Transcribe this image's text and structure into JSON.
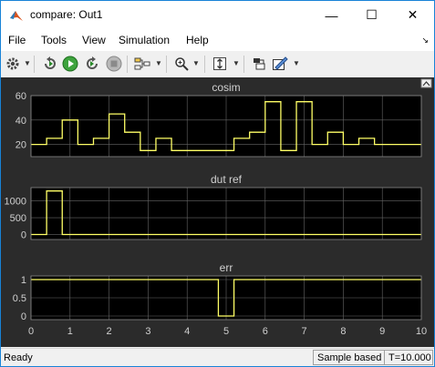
{
  "window": {
    "title": "compare: Out1"
  },
  "window_controls": {
    "minimize": "—",
    "maximize": "☐",
    "close": "✕"
  },
  "menu": [
    "File",
    "Tools",
    "View",
    "Simulation",
    "Help"
  ],
  "toolbar": {
    "icons": [
      "gear-icon",
      "step-back-icon",
      "run-icon",
      "stop-icon",
      "highlight-icon",
      "zoom-icon",
      "fit-icon",
      "layout-icon",
      "style-icon"
    ]
  },
  "colors": {
    "plot_bg": "#000000",
    "plot_frame_bg": "#2b2b2b",
    "trace": "#ffff66",
    "grid": "#666666",
    "text": "#d0d0d0"
  },
  "chart_data": [
    {
      "type": "line",
      "step": true,
      "title": "cosim",
      "xlim": [
        0,
        10
      ],
      "ylim": [
        10,
        60
      ],
      "yticks": [
        20,
        40,
        60
      ],
      "xticks": [],
      "grid": true,
      "x": [
        0,
        0.4,
        0.8,
        1.2,
        1.6,
        2.0,
        2.4,
        2.8,
        3.2,
        3.6,
        4.0,
        4.8,
        5.2,
        5.6,
        6.0,
        6.4,
        6.8,
        7.2,
        7.6,
        8.0,
        8.4,
        8.8,
        9.2,
        10.0
      ],
      "values": [
        20,
        25,
        40,
        20,
        25,
        45,
        30,
        15,
        25,
        15,
        15,
        15,
        25,
        30,
        55,
        15,
        55,
        20,
        30,
        20,
        25,
        20,
        20,
        20
      ]
    },
    {
      "type": "line",
      "step": true,
      "title": "dut ref",
      "xlim": [
        0,
        10
      ],
      "ylim": [
        -150,
        1400
      ],
      "yticks": [
        0,
        500,
        1000
      ],
      "xticks": [],
      "grid": true,
      "x": [
        0,
        0.4,
        0.8,
        10.0
      ],
      "values": [
        0,
        1300,
        0,
        0
      ]
    },
    {
      "type": "line",
      "step": true,
      "title": "err",
      "xlim": [
        0,
        10
      ],
      "ylim": [
        -0.1,
        1.1
      ],
      "yticks": [
        0,
        0.5,
        1
      ],
      "xticks": [
        0,
        1,
        2,
        3,
        4,
        5,
        6,
        7,
        8,
        9,
        10
      ],
      "grid": true,
      "x": [
        0,
        4.8,
        5.2,
        10.0
      ],
      "values": [
        1,
        0,
        1,
        1
      ]
    }
  ],
  "status": {
    "left": "Ready",
    "mode": "Sample based",
    "time": "T=10.000"
  }
}
